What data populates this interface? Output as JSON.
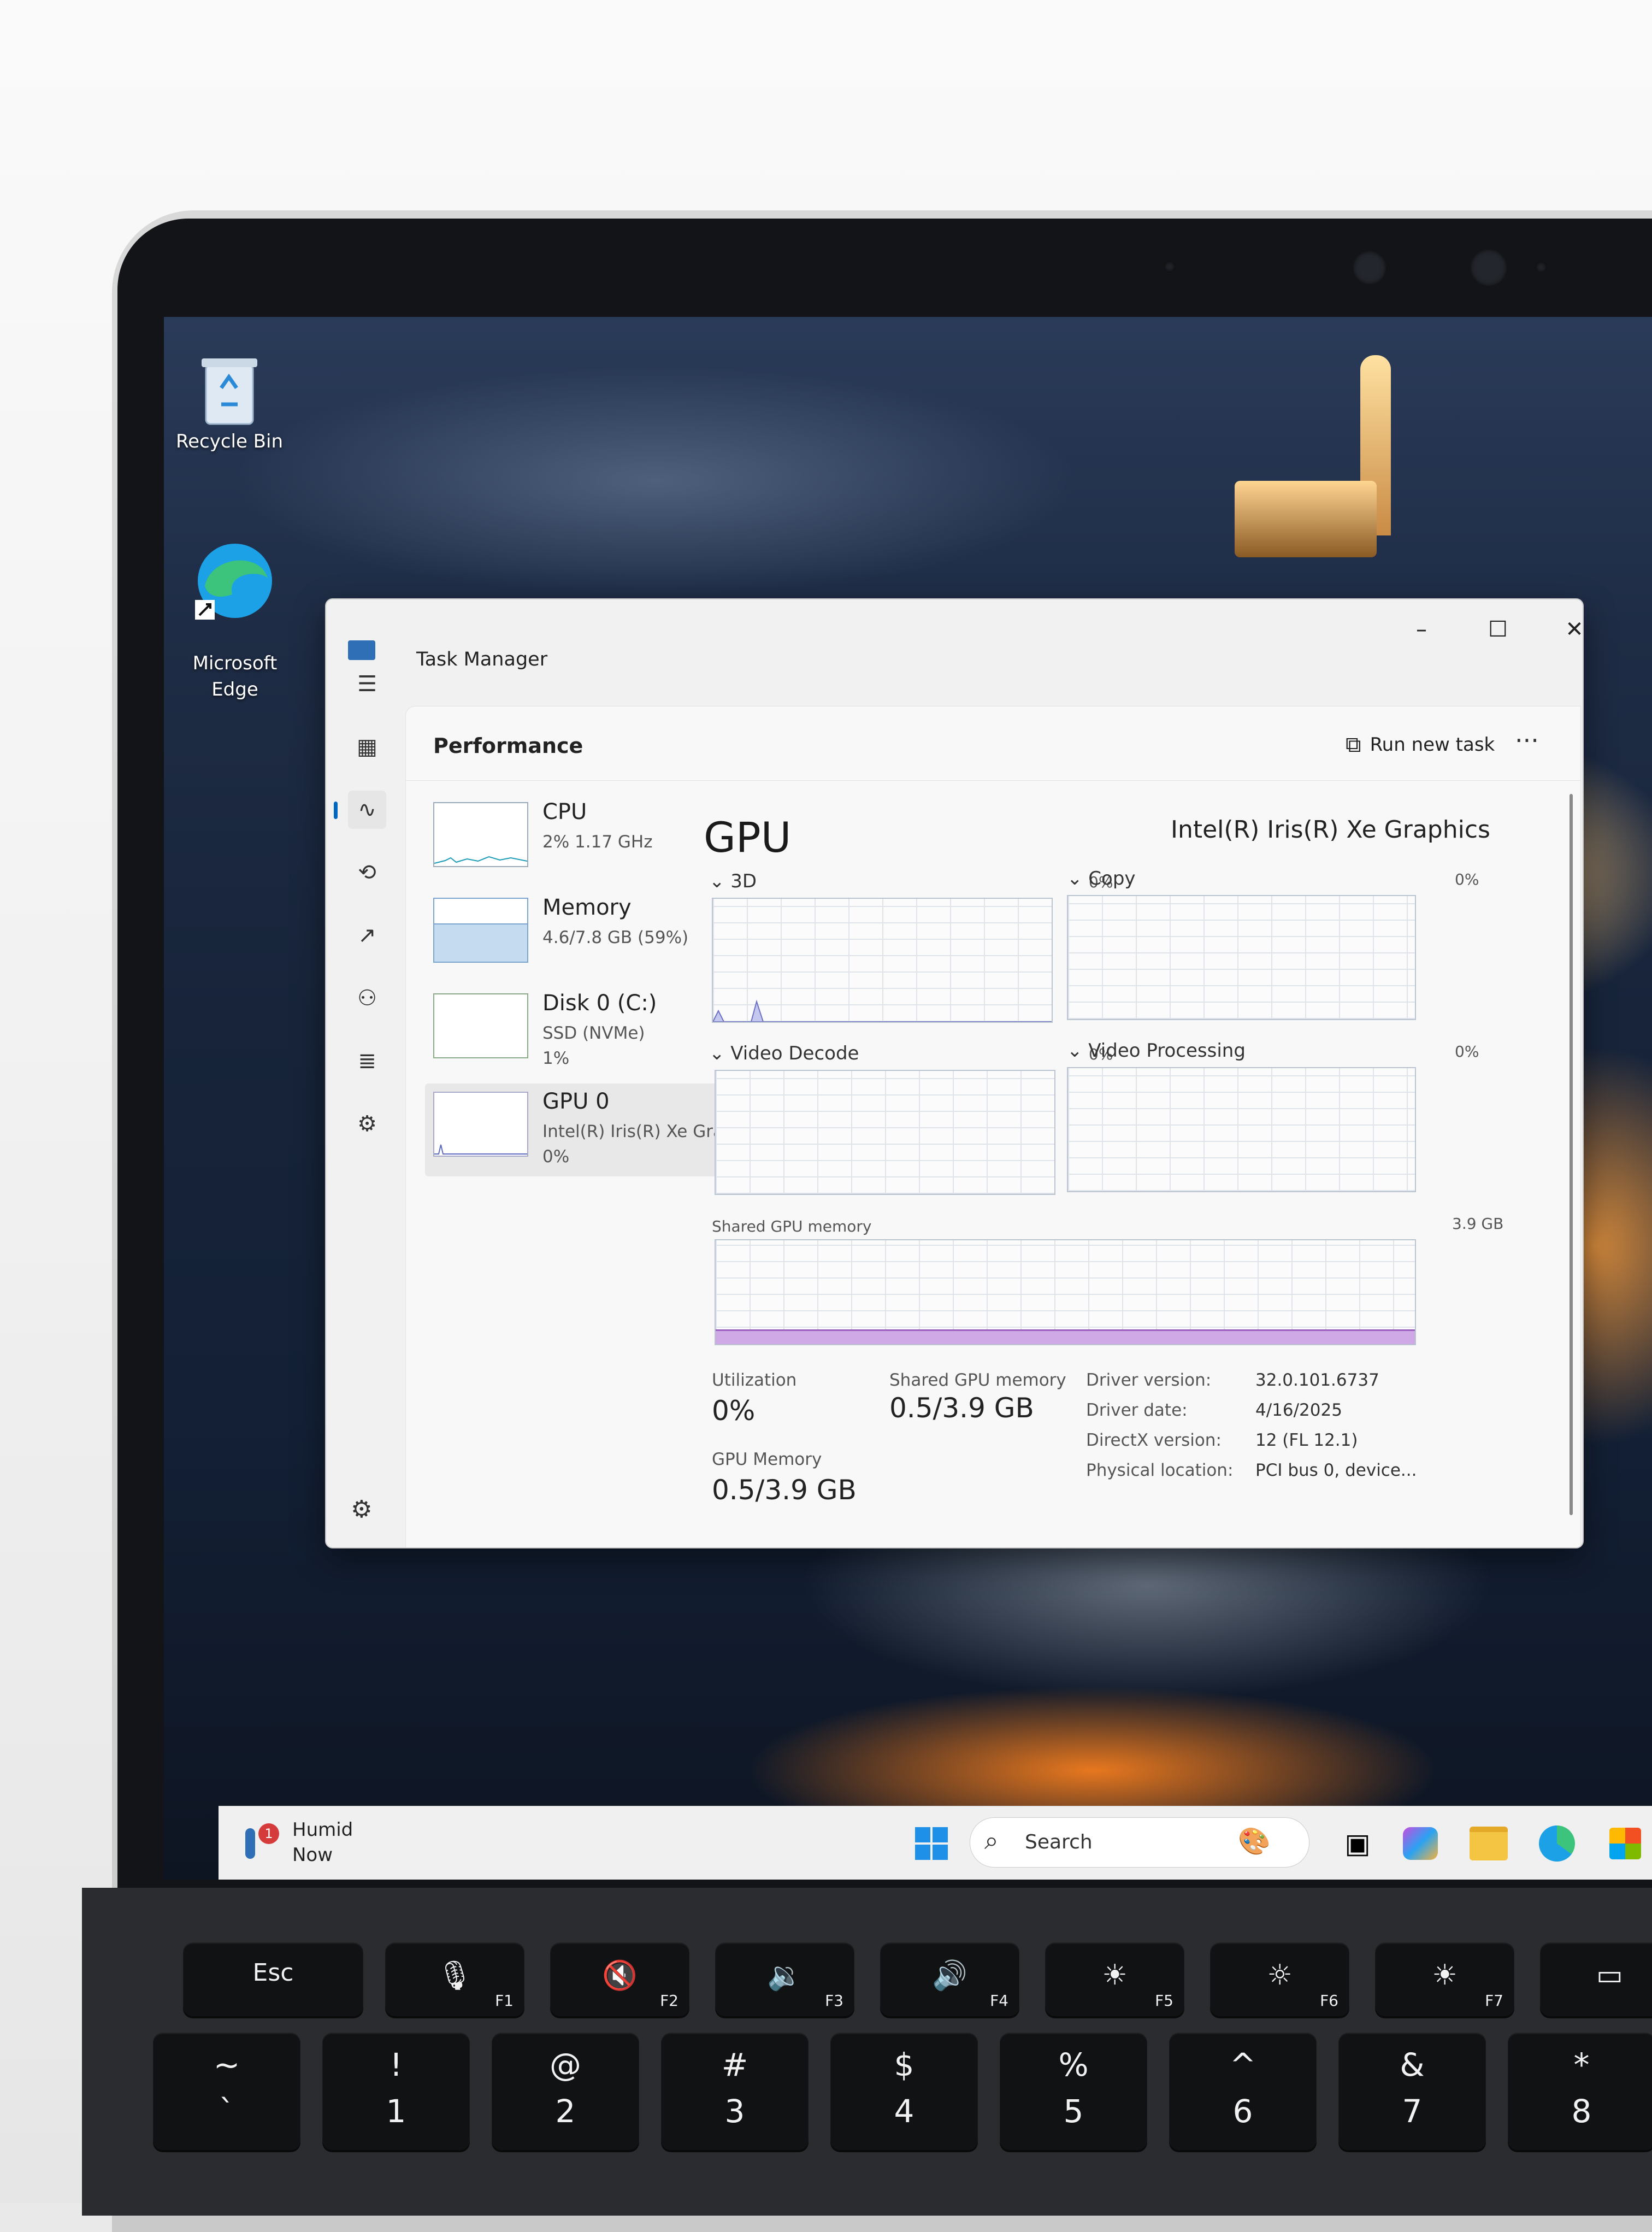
{
  "desktop": {
    "icons": [
      {
        "label": "Recycle Bin"
      },
      {
        "label": "Microsoft\nEdge"
      }
    ]
  },
  "task_manager": {
    "window_title": "Task Manager",
    "page_title": "Performance",
    "run_new_task": "Run new task",
    "more": "···",
    "resources": [
      {
        "name": "CPU",
        "sub": "2% 1.17 GHz"
      },
      {
        "name": "Memory",
        "sub": "4.6/7.8 GB (59%)",
        "fill": 0.59
      },
      {
        "name": "Disk 0 (C:)",
        "sub": "SSD (NVMe)",
        "sub2": "1%"
      },
      {
        "name": "GPU 0",
        "sub": "Intel(R) Iris(R) Xe Graphi",
        "sub2": "0%"
      }
    ],
    "gpu": {
      "title": "GPU",
      "model": "Intel(R) Iris(R) Xe Graphics",
      "engines": [
        {
          "label": "3D",
          "pct": "0%"
        },
        {
          "label": "Copy",
          "pct": "0%"
        },
        {
          "label": "Video Decode",
          "pct": "0%"
        },
        {
          "label": "Video Processing",
          "pct": "0%"
        }
      ],
      "shared_memory_label": "Shared GPU memory",
      "shared_memory_max": "3.9 GB",
      "stats": {
        "utilization_label": "Utilization",
        "utilization": "0%",
        "shared_label": "Shared GPU memory",
        "shared": "0.5/3.9 GB",
        "gpu_memory_label": "GPU Memory",
        "gpu_memory": "0.5/3.9 GB"
      },
      "details": [
        {
          "k": "Driver version:",
          "v": "32.0.101.6737"
        },
        {
          "k": "Driver date:",
          "v": "4/16/2025"
        },
        {
          "k": "DirectX version:",
          "v": "12 (FL 12.1)"
        },
        {
          "k": "Physical location:",
          "v": "PCI bus 0, device..."
        }
      ]
    }
  },
  "taskbar": {
    "weather_label": "Humid",
    "weather_time": "Now",
    "badge": "1",
    "search": "Search"
  },
  "keyboard": {
    "row1": [
      {
        "top": "Esc",
        "fn": ""
      },
      {
        "top": "🎙",
        "fn": "F1"
      },
      {
        "top": "🔇",
        "fn": "F2"
      },
      {
        "top": "🔉",
        "fn": "F3"
      },
      {
        "top": "🔊",
        "fn": "F4"
      },
      {
        "top": "☀",
        "fn": "F5"
      },
      {
        "top": "☼",
        "fn": "F6"
      },
      {
        "top": "☀",
        "fn": "F7"
      },
      {
        "top": "▭",
        "fn": ""
      }
    ],
    "row2": [
      {
        "top": "~",
        "bot": "`"
      },
      {
        "top": "!",
        "bot": "1"
      },
      {
        "top": "@",
        "bot": "2"
      },
      {
        "top": "#",
        "bot": "3"
      },
      {
        "top": "$",
        "bot": "4"
      },
      {
        "top": "%",
        "bot": "5"
      },
      {
        "top": "^",
        "bot": "6"
      },
      {
        "top": "&",
        "bot": "7"
      },
      {
        "top": "*",
        "bot": "8"
      }
    ]
  }
}
